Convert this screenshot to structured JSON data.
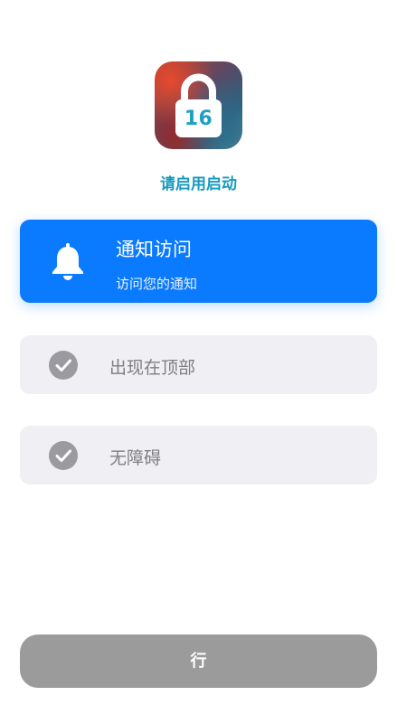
{
  "app": {
    "icon": "lock-16-icon",
    "icon_number": "16",
    "prompt": "请启用启动"
  },
  "permissions": {
    "active": {
      "icon": "bell-icon",
      "title": "通知访问",
      "subtitle": "访问您的通知"
    },
    "items": [
      {
        "icon": "checkmark-circle-icon",
        "label": "出现在顶部"
      },
      {
        "icon": "checkmark-circle-icon",
        "label": "无障碍"
      }
    ]
  },
  "footer": {
    "button_label": "行"
  },
  "colors": {
    "accent": "#0a7aff",
    "prompt_text": "#1899bf",
    "item_bg": "#efeff4",
    "check_gray": "#9a9aa0",
    "button_gray": "#9b9b9b"
  }
}
